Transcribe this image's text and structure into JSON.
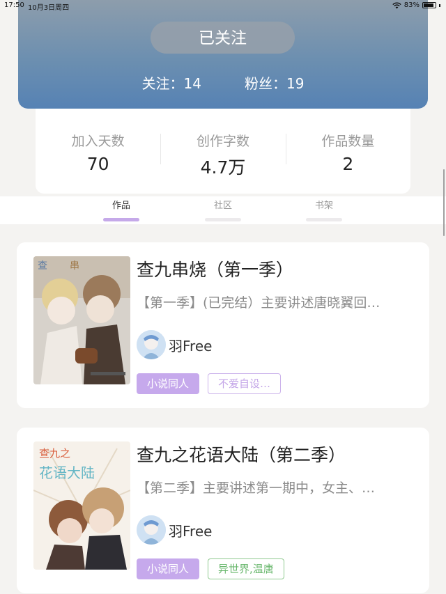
{
  "status_bar": {
    "time": "17:50",
    "date": "10月3日周四",
    "battery": "83%"
  },
  "profile": {
    "follow_button": "已关注",
    "following": "关注：14",
    "followers": "粉丝：19"
  },
  "stats": [
    {
      "label": "加入天数",
      "value": "70"
    },
    {
      "label": "创作字数",
      "value": "4.7万"
    },
    {
      "label": "作品数量",
      "value": "2"
    }
  ],
  "tabs": [
    {
      "label": "作品",
      "active": true
    },
    {
      "label": "社区",
      "active": false
    },
    {
      "label": "书架",
      "active": false
    }
  ],
  "books": [
    {
      "title": "查九串烧（第一季）",
      "description": "【第一季】(已完结）主要讲述唐晓翼回…",
      "author": "羽Free",
      "tags": [
        "小说同人",
        "不爱自设…"
      ]
    },
    {
      "title": "查九之花语大陆（第二季）",
      "description": "【第二季】主要讲述第一期中，女主、…",
      "author": "羽Free",
      "tags": [
        "小说同人",
        "异世界,温唐"
      ]
    }
  ]
}
